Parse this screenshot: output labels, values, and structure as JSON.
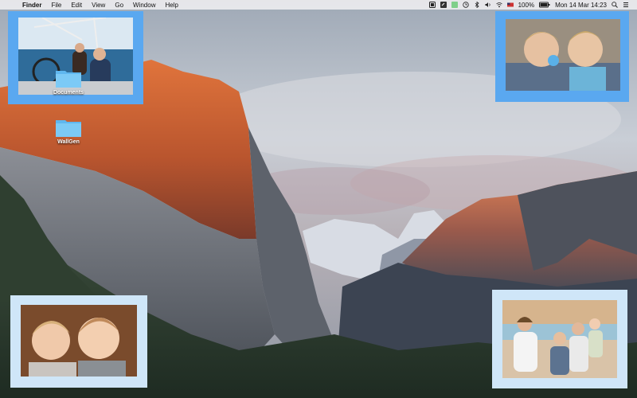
{
  "menubar": {
    "app_name": "Finder",
    "menus": [
      "File",
      "Edit",
      "View",
      "Go",
      "Window",
      "Help"
    ],
    "battery": "100%",
    "datetime": "Mon 14 Mar  14:23"
  },
  "desktop_icons": [
    {
      "label": "Documents"
    },
    {
      "label": "WallGen"
    }
  ],
  "colors": {
    "frame_blue": "#5aa8f0",
    "frame_light": "#bfe0f8",
    "sunlit_rock": "#d2683a"
  }
}
